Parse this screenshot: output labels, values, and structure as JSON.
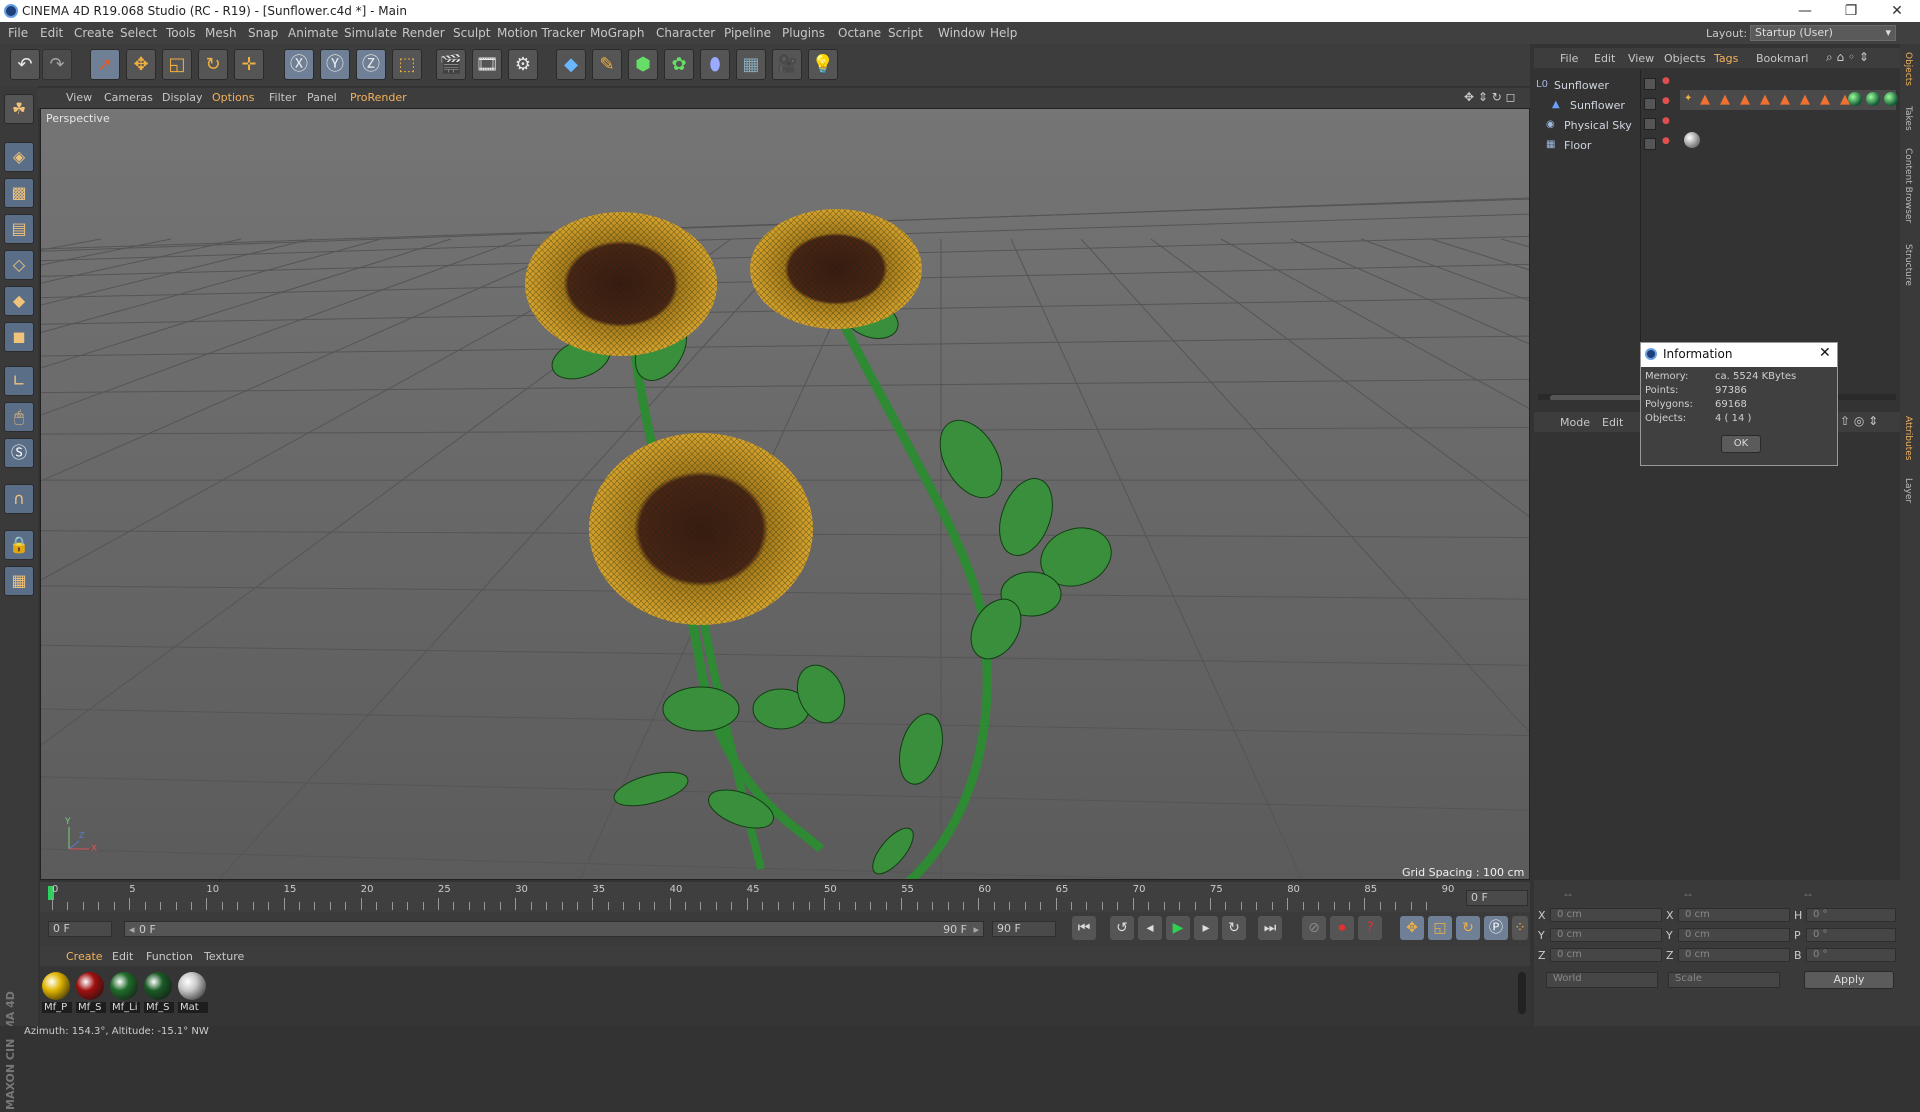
{
  "window": {
    "title": "CINEMA 4D R19.068 Studio (RC - R19) - [Sunflower.c4d *] - Main",
    "min": "—",
    "max": "❐",
    "close": "✕"
  },
  "menu": [
    {
      "label": "File",
      "hl": false
    },
    {
      "label": "Edit",
      "hl": false
    },
    {
      "label": "Create",
      "hl": false
    },
    {
      "label": "Select",
      "hl": false
    },
    {
      "label": "Tools",
      "hl": false
    },
    {
      "label": "Mesh",
      "hl": false
    },
    {
      "label": "Snap",
      "hl": false
    },
    {
      "label": "Animate",
      "hl": false
    },
    {
      "label": "Simulate",
      "hl": false
    },
    {
      "label": "Render",
      "hl": false
    },
    {
      "label": "Sculpt",
      "hl": false
    },
    {
      "label": "Motion Tracker",
      "hl": false
    },
    {
      "label": "MoGraph",
      "hl": false
    },
    {
      "label": "Character",
      "hl": false
    },
    {
      "label": "Pipeline",
      "hl": false
    },
    {
      "label": "Plugins",
      "hl": false
    },
    {
      "label": "Octane",
      "hl": false
    },
    {
      "label": "Script",
      "hl": false
    },
    {
      "label": "Window",
      "hl": false
    },
    {
      "label": "Help",
      "hl": false
    }
  ],
  "layout": {
    "label": "Layout:",
    "value": "Startup (User)"
  },
  "viewport_menu": [
    "View",
    "Cameras",
    "Display",
    "Options",
    "Filter",
    "Panel",
    "ProRender"
  ],
  "viewport": {
    "name": "Perspective",
    "grid_spacing": "Grid Spacing : 100 cm",
    "axis_y": "Y",
    "axis_x": "X",
    "axis_z": "Z"
  },
  "timeline": {
    "ticks": [
      "0",
      "5",
      "10",
      "15",
      "20",
      "25",
      "30",
      "35",
      "40",
      "45",
      "50",
      "55",
      "60",
      "65",
      "70",
      "75",
      "80",
      "85",
      "90"
    ],
    "end_frame": "0 F"
  },
  "transport": {
    "start": "0 F",
    "range_start": "0 F",
    "range_end": "90 F",
    "end": "90 F"
  },
  "material_menu": [
    "Create",
    "Edit",
    "Function",
    "Texture"
  ],
  "materials": [
    {
      "label": "Mf_P",
      "color": "#e0b400"
    },
    {
      "label": "Mf_S",
      "color": "#a01010"
    },
    {
      "label": "Mf_Li",
      "color": "#1f6b2a"
    },
    {
      "label": "Mf_S",
      "color": "#1a5a25"
    },
    {
      "label": "Mat",
      "color": "#c8c8c8"
    }
  ],
  "status": "Azimuth: 154.3°, Altitude: -15.1°  NW",
  "brand": "MAXON CINEMA 4D",
  "object_menu": [
    "File",
    "Edit",
    "View",
    "Objects",
    "Tags",
    "Bookmarl"
  ],
  "objects": [
    {
      "name": "Sunflower",
      "type": "null"
    },
    {
      "name": "Sunflower",
      "type": "mesh"
    },
    {
      "name": "Physical Sky",
      "type": "sky"
    },
    {
      "name": "Floor",
      "type": "floor"
    }
  ],
  "attr_menu": [
    "Mode",
    "Edit"
  ],
  "coords": {
    "x_pos": "0 cm",
    "y_pos": "0 cm",
    "z_pos": "0 cm",
    "x_size": "0 cm",
    "y_size": "0 cm",
    "z_size": "0 cm",
    "h": "0 °",
    "p": "0 °",
    "b": "0 °",
    "space": "World",
    "mode": "Scale",
    "apply": "Apply",
    "col1": "--",
    "col2": "--",
    "col3": "--"
  },
  "right_tabs": [
    "Objects",
    "Takes",
    "Content Browser",
    "Structure",
    "Attributes",
    "Layer"
  ],
  "info_dialog": {
    "title": "Information",
    "rows": [
      {
        "k": "Memory:",
        "v": "ca. 5524 KBytes"
      },
      {
        "k": "Points:",
        "v": "97386"
      },
      {
        "k": "Polygons:",
        "v": "69168"
      },
      {
        "k": "Objects:",
        "v": "4 ( 14 )"
      }
    ],
    "ok": "OK"
  },
  "colors": {
    "accent": "#f2b25c",
    "viewport_bg": "#6b6b6b"
  }
}
